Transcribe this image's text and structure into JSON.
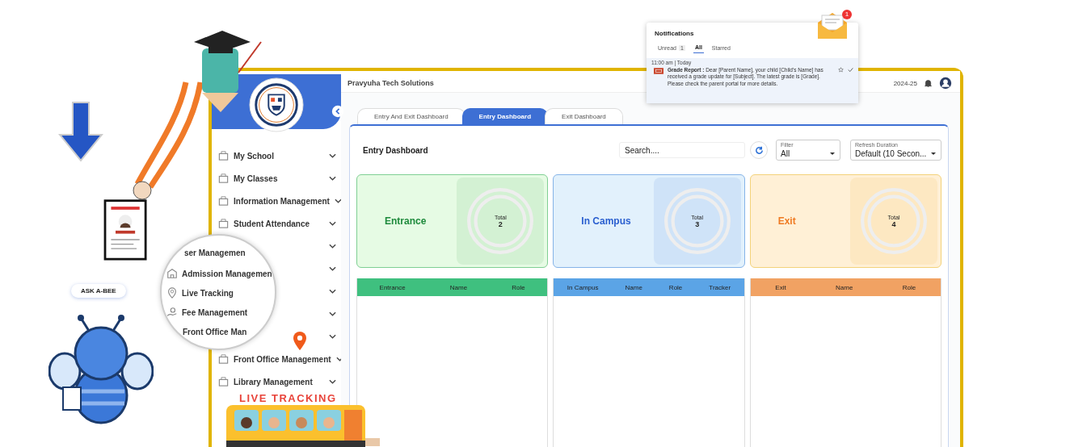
{
  "header": {
    "company": "Pravyuha Tech Solutions",
    "year": "2024-25"
  },
  "sidebar": {
    "items": [
      {
        "label": "My School"
      },
      {
        "label": "My Classes"
      },
      {
        "label": "Information Management"
      },
      {
        "label": "Student Attendance"
      },
      {
        "label": "Front Office Management"
      },
      {
        "label": "Library Management"
      }
    ]
  },
  "tabs": [
    {
      "label": "Entry And Exit Dashboard",
      "selected": false
    },
    {
      "label": "Entry Dashboard",
      "selected": true
    },
    {
      "label": "Exit Dashboard",
      "selected": false
    }
  ],
  "dashboard": {
    "title": "Entry Dashboard",
    "search": {
      "placeholder": "Search...."
    },
    "filter": {
      "label": "Filter",
      "value": "All"
    },
    "refresh": {
      "label": "Refresh Duration",
      "value": "Default (10 Secon..."
    }
  },
  "cards": [
    {
      "kind": "entrance",
      "label": "Entrance",
      "total_label": "Total",
      "total": "2"
    },
    {
      "kind": "campus",
      "label": "In Campus",
      "total_label": "Total",
      "total": "3"
    },
    {
      "kind": "exit",
      "label": "Exit",
      "total_label": "Total",
      "total": "4"
    }
  ],
  "tables": [
    {
      "kind": "entrance",
      "columns": [
        "Entrance",
        "Name",
        "Role"
      ]
    },
    {
      "kind": "campus",
      "columns": [
        "In Campus",
        "Name",
        "Role",
        "Tracker"
      ]
    },
    {
      "kind": "exit",
      "columns": [
        "Exit",
        "Name",
        "Role"
      ]
    }
  ],
  "notifications": {
    "title": "Notifications",
    "badge": "1",
    "tabs": [
      {
        "label": "Unread",
        "count": "1",
        "selected": false
      },
      {
        "label": "All",
        "selected": true
      },
      {
        "label": "Starred",
        "selected": false
      }
    ],
    "items": [
      {
        "time": "11:00 am | Today",
        "message": "**Grade Report :** Dear [Parent Name], your child [Child's Name] has received a grade update for [Subject]. The latest grade is [Grade]. Please check the parent portal for more details."
      }
    ]
  },
  "magnifier": {
    "items": [
      {
        "kind": "plain",
        "label": "ser Managemen"
      },
      {
        "kind": "admission",
        "label": "Admission Managemen"
      },
      {
        "kind": "pin",
        "label": "Live Tracking"
      },
      {
        "kind": "fee",
        "label": "Fee Management"
      },
      {
        "kind": "plain",
        "label": "Front Office Man"
      }
    ]
  },
  "promo": {
    "ask": "ASK A-BEE",
    "banner": "LIVE TRACKING"
  }
}
